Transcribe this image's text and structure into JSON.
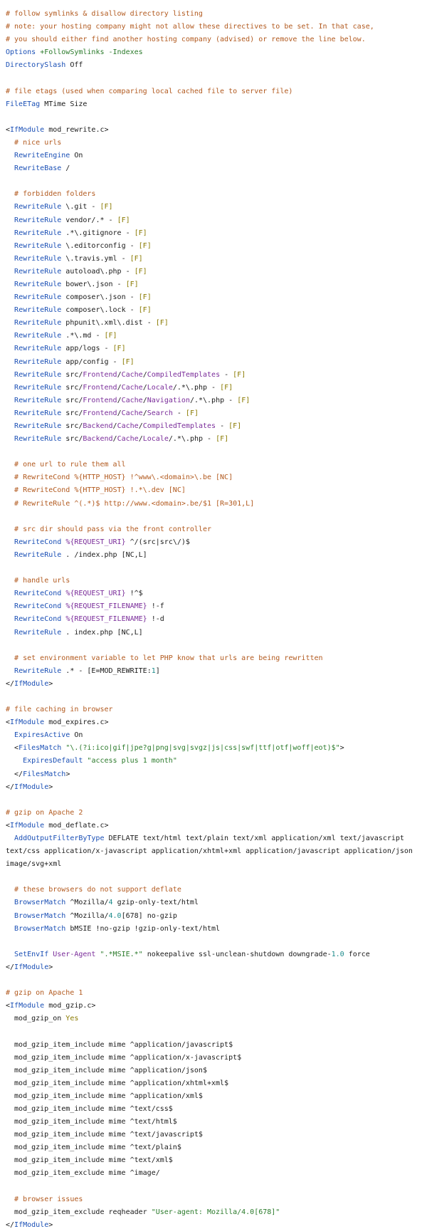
{
  "lines": [
    [
      [
        "c",
        "# follow symlinks & disallow directory listing"
      ]
    ],
    [
      [
        "c",
        "# note: your hosting company might not allow these directives to be set. In that case,"
      ]
    ],
    [
      [
        "c",
        "# you should either find another hosting company (advised) or remove the line below."
      ]
    ],
    [
      [
        "k",
        "Options"
      ],
      [
        "p",
        " "
      ],
      [
        "g",
        "+FollowSymlinks -Indexes"
      ]
    ],
    [
      [
        "k",
        "DirectorySlash"
      ],
      [
        "p",
        " Off"
      ]
    ],
    [],
    [
      [
        "c",
        "# file etags (used when comparing local cached file to server file)"
      ]
    ],
    [
      [
        "k",
        "FileETag"
      ],
      [
        "p",
        " MTime Size"
      ]
    ],
    [],
    [
      [
        "p",
        "<"
      ],
      [
        "t",
        "IfModule"
      ],
      [
        "p",
        " mod_rewrite.c>"
      ]
    ],
    [
      [
        "p",
        "  "
      ],
      [
        "c",
        "# nice urls"
      ]
    ],
    [
      [
        "p",
        "  "
      ],
      [
        "k",
        "RewriteEngine"
      ],
      [
        "p",
        " On"
      ]
    ],
    [
      [
        "p",
        "  "
      ],
      [
        "k",
        "RewriteBase"
      ],
      [
        "p",
        " /"
      ]
    ],
    [],
    [
      [
        "p",
        "  "
      ],
      [
        "c",
        "# forbidden folders"
      ]
    ],
    [
      [
        "p",
        "  "
      ],
      [
        "k",
        "RewriteRule"
      ],
      [
        "p",
        " \\.git - "
      ],
      [
        "f",
        "[F]"
      ]
    ],
    [
      [
        "p",
        "  "
      ],
      [
        "k",
        "RewriteRule"
      ],
      [
        "p",
        " vendor/.* - "
      ],
      [
        "f",
        "[F]"
      ]
    ],
    [
      [
        "p",
        "  "
      ],
      [
        "k",
        "RewriteRule"
      ],
      [
        "p",
        " .*\\.gitignore - "
      ],
      [
        "f",
        "[F]"
      ]
    ],
    [
      [
        "p",
        "  "
      ],
      [
        "k",
        "RewriteRule"
      ],
      [
        "p",
        " \\.editorconfig - "
      ],
      [
        "f",
        "[F]"
      ]
    ],
    [
      [
        "p",
        "  "
      ],
      [
        "k",
        "RewriteRule"
      ],
      [
        "p",
        " \\.travis.yml - "
      ],
      [
        "f",
        "[F]"
      ]
    ],
    [
      [
        "p",
        "  "
      ],
      [
        "k",
        "RewriteRule"
      ],
      [
        "p",
        " autoload\\.php - "
      ],
      [
        "f",
        "[F]"
      ]
    ],
    [
      [
        "p",
        "  "
      ],
      [
        "k",
        "RewriteRule"
      ],
      [
        "p",
        " bower\\.json - "
      ],
      [
        "f",
        "[F]"
      ]
    ],
    [
      [
        "p",
        "  "
      ],
      [
        "k",
        "RewriteRule"
      ],
      [
        "p",
        " composer\\.json - "
      ],
      [
        "f",
        "[F]"
      ]
    ],
    [
      [
        "p",
        "  "
      ],
      [
        "k",
        "RewriteRule"
      ],
      [
        "p",
        " composer\\.lock - "
      ],
      [
        "f",
        "[F]"
      ]
    ],
    [
      [
        "p",
        "  "
      ],
      [
        "k",
        "RewriteRule"
      ],
      [
        "p",
        " phpunit\\.xml\\.dist - "
      ],
      [
        "f",
        "[F]"
      ]
    ],
    [
      [
        "p",
        "  "
      ],
      [
        "k",
        "RewriteRule"
      ],
      [
        "p",
        " .*\\.md - "
      ],
      [
        "f",
        "[F]"
      ]
    ],
    [
      [
        "p",
        "  "
      ],
      [
        "k",
        "RewriteRule"
      ],
      [
        "p",
        " app/logs - "
      ],
      [
        "f",
        "[F]"
      ]
    ],
    [
      [
        "p",
        "  "
      ],
      [
        "k",
        "RewriteRule"
      ],
      [
        "p",
        " app/config - "
      ],
      [
        "f",
        "[F]"
      ]
    ],
    [
      [
        "p",
        "  "
      ],
      [
        "k",
        "RewriteRule"
      ],
      [
        "p",
        " src/"
      ],
      [
        "v",
        "Frontend"
      ],
      [
        "p",
        "/"
      ],
      [
        "v",
        "Cache"
      ],
      [
        "p",
        "/"
      ],
      [
        "v",
        "CompiledTemplates"
      ],
      [
        "p",
        " - "
      ],
      [
        "f",
        "[F]"
      ]
    ],
    [
      [
        "p",
        "  "
      ],
      [
        "k",
        "RewriteRule"
      ],
      [
        "p",
        " src/"
      ],
      [
        "v",
        "Frontend"
      ],
      [
        "p",
        "/"
      ],
      [
        "v",
        "Cache"
      ],
      [
        "p",
        "/"
      ],
      [
        "v",
        "Locale"
      ],
      [
        "p",
        "/.*\\.php - "
      ],
      [
        "f",
        "[F]"
      ]
    ],
    [
      [
        "p",
        "  "
      ],
      [
        "k",
        "RewriteRule"
      ],
      [
        "p",
        " src/"
      ],
      [
        "v",
        "Frontend"
      ],
      [
        "p",
        "/"
      ],
      [
        "v",
        "Cache"
      ],
      [
        "p",
        "/"
      ],
      [
        "v",
        "Navigation"
      ],
      [
        "p",
        "/.*\\.php - "
      ],
      [
        "f",
        "[F]"
      ]
    ],
    [
      [
        "p",
        "  "
      ],
      [
        "k",
        "RewriteRule"
      ],
      [
        "p",
        " src/"
      ],
      [
        "v",
        "Frontend"
      ],
      [
        "p",
        "/"
      ],
      [
        "v",
        "Cache"
      ],
      [
        "p",
        "/"
      ],
      [
        "v",
        "Search"
      ],
      [
        "p",
        " - "
      ],
      [
        "f",
        "[F]"
      ]
    ],
    [
      [
        "p",
        "  "
      ],
      [
        "k",
        "RewriteRule"
      ],
      [
        "p",
        " src/"
      ],
      [
        "v",
        "Backend"
      ],
      [
        "p",
        "/"
      ],
      [
        "v",
        "Cache"
      ],
      [
        "p",
        "/"
      ],
      [
        "v",
        "CompiledTemplates"
      ],
      [
        "p",
        " - "
      ],
      [
        "f",
        "[F]"
      ]
    ],
    [
      [
        "p",
        "  "
      ],
      [
        "k",
        "RewriteRule"
      ],
      [
        "p",
        " src/"
      ],
      [
        "v",
        "Backend"
      ],
      [
        "p",
        "/"
      ],
      [
        "v",
        "Cache"
      ],
      [
        "p",
        "/"
      ],
      [
        "v",
        "Locale"
      ],
      [
        "p",
        "/.*\\.php - "
      ],
      [
        "f",
        "[F]"
      ]
    ],
    [],
    [
      [
        "p",
        "  "
      ],
      [
        "c",
        "# one url to rule them all"
      ]
    ],
    [
      [
        "p",
        "  "
      ],
      [
        "c",
        "# RewriteCond %{HTTP_HOST} !^www\\.<domain>\\.be [NC]"
      ]
    ],
    [
      [
        "p",
        "  "
      ],
      [
        "c",
        "# RewriteCond %{HTTP_HOST} !.*\\.dev [NC]"
      ]
    ],
    [
      [
        "p",
        "  "
      ],
      [
        "c",
        "# RewriteRule ^(.*)$ http://www.<domain>.be/$1 [R=301,L]"
      ]
    ],
    [],
    [
      [
        "p",
        "  "
      ],
      [
        "c",
        "# src dir should pass via the front controller"
      ]
    ],
    [
      [
        "p",
        "  "
      ],
      [
        "k",
        "RewriteCond"
      ],
      [
        "p",
        " "
      ],
      [
        "v",
        "%{REQUEST_URI}"
      ],
      [
        "p",
        " ^/(src|src\\/)$"
      ]
    ],
    [
      [
        "p",
        "  "
      ],
      [
        "k",
        "RewriteRule"
      ],
      [
        "p",
        " . /index.php [NC,L]"
      ]
    ],
    [],
    [
      [
        "p",
        "  "
      ],
      [
        "c",
        "# handle urls"
      ]
    ],
    [
      [
        "p",
        "  "
      ],
      [
        "k",
        "RewriteCond"
      ],
      [
        "p",
        " "
      ],
      [
        "v",
        "%{REQUEST_URI}"
      ],
      [
        "p",
        " !^$"
      ]
    ],
    [
      [
        "p",
        "  "
      ],
      [
        "k",
        "RewriteCond"
      ],
      [
        "p",
        " "
      ],
      [
        "v",
        "%{REQUEST_FILENAME}"
      ],
      [
        "p",
        " !-f"
      ]
    ],
    [
      [
        "p",
        "  "
      ],
      [
        "k",
        "RewriteCond"
      ],
      [
        "p",
        " "
      ],
      [
        "v",
        "%{REQUEST_FILENAME}"
      ],
      [
        "p",
        " !-d"
      ]
    ],
    [
      [
        "p",
        "  "
      ],
      [
        "k",
        "RewriteRule"
      ],
      [
        "p",
        " . index.php [NC,L]"
      ]
    ],
    [],
    [
      [
        "p",
        "  "
      ],
      [
        "c",
        "# set environment variable to let PHP know that urls are being rewritten"
      ]
    ],
    [
      [
        "p",
        "  "
      ],
      [
        "k",
        "RewriteRule"
      ],
      [
        "p",
        " .* - [E=MOD_REWRITE:"
      ],
      [
        "n",
        "1"
      ],
      [
        "p",
        "]"
      ]
    ],
    [
      [
        "p",
        "</"
      ],
      [
        "t",
        "IfModule"
      ],
      [
        "p",
        ">"
      ]
    ],
    [],
    [
      [
        "c",
        "# file caching in browser"
      ]
    ],
    [
      [
        "p",
        "<"
      ],
      [
        "t",
        "IfModule"
      ],
      [
        "p",
        " mod_expires.c>"
      ]
    ],
    [
      [
        "p",
        "  "
      ],
      [
        "k",
        "ExpiresActive"
      ],
      [
        "p",
        " On"
      ]
    ],
    [
      [
        "p",
        "  <"
      ],
      [
        "t",
        "FilesMatch"
      ],
      [
        "p",
        " "
      ],
      [
        "s",
        "\"\\.(?i:ico|gif|jpe?g|png|svg|svgz|js|css|swf|ttf|otf|woff|eot)$\""
      ],
      [
        "p",
        ">"
      ]
    ],
    [
      [
        "p",
        "    "
      ],
      [
        "k",
        "ExpiresDefault"
      ],
      [
        "p",
        " "
      ],
      [
        "s",
        "\"access plus 1 month\""
      ]
    ],
    [
      [
        "p",
        "  </"
      ],
      [
        "t",
        "FilesMatch"
      ],
      [
        "p",
        ">"
      ]
    ],
    [
      [
        "p",
        "</"
      ],
      [
        "t",
        "IfModule"
      ],
      [
        "p",
        ">"
      ]
    ],
    [],
    [
      [
        "c",
        "# gzip on Apache 2"
      ]
    ],
    [
      [
        "p",
        "<"
      ],
      [
        "t",
        "IfModule"
      ],
      [
        "p",
        " mod_deflate.c>"
      ]
    ],
    [
      [
        "p",
        "  "
      ],
      [
        "k",
        "AddOutputFilterByType"
      ],
      [
        "p",
        " DEFLATE text/html text/plain text/xml application/xml text/javascript"
      ]
    ],
    [
      [
        "p",
        "text/css application/x-javascript application/xhtml+xml application/javascript application/json"
      ]
    ],
    [
      [
        "p",
        "image/svg+xml"
      ]
    ],
    [],
    [
      [
        "p",
        "  "
      ],
      [
        "c",
        "# these browsers do not support deflate"
      ]
    ],
    [
      [
        "p",
        "  "
      ],
      [
        "k",
        "BrowserMatch"
      ],
      [
        "p",
        " ^Mozilla/"
      ],
      [
        "n",
        "4"
      ],
      [
        "p",
        " gzip-only-text/html"
      ]
    ],
    [
      [
        "p",
        "  "
      ],
      [
        "k",
        "BrowserMatch"
      ],
      [
        "p",
        " ^Mozilla/"
      ],
      [
        "n",
        "4.0"
      ],
      [
        "p",
        "[678] no-gzip"
      ]
    ],
    [
      [
        "p",
        "  "
      ],
      [
        "k",
        "BrowserMatch"
      ],
      [
        "p",
        " bMSIE !no-gzip !gzip-only-text/html"
      ]
    ],
    [],
    [
      [
        "p",
        "  "
      ],
      [
        "k",
        "SetEnvIf"
      ],
      [
        "p",
        " "
      ],
      [
        "v",
        "User-Agent"
      ],
      [
        "p",
        " "
      ],
      [
        "s",
        "\".*MSIE.*\""
      ],
      [
        "p",
        " nokeepalive ssl-unclean-shutdown downgrade-"
      ],
      [
        "n",
        "1.0"
      ],
      [
        "p",
        " force"
      ]
    ],
    [
      [
        "p",
        "</"
      ],
      [
        "t",
        "IfModule"
      ],
      [
        "p",
        ">"
      ]
    ],
    [],
    [
      [
        "c",
        "# gzip on Apache 1"
      ]
    ],
    [
      [
        "p",
        "<"
      ],
      [
        "t",
        "IfModule"
      ],
      [
        "p",
        " mod_gzip.c>"
      ]
    ],
    [
      [
        "p",
        "  mod_gzip_on "
      ],
      [
        "f",
        "Yes"
      ]
    ],
    [],
    [
      [
        "p",
        "  mod_gzip_item_include mime ^application/javascript$"
      ]
    ],
    [
      [
        "p",
        "  mod_gzip_item_include mime ^application/x-javascript$"
      ]
    ],
    [
      [
        "p",
        "  mod_gzip_item_include mime ^application/json$"
      ]
    ],
    [
      [
        "p",
        "  mod_gzip_item_include mime ^application/xhtml+xml$"
      ]
    ],
    [
      [
        "p",
        "  mod_gzip_item_include mime ^application/xml$"
      ]
    ],
    [
      [
        "p",
        "  mod_gzip_item_include mime ^text/css$"
      ]
    ],
    [
      [
        "p",
        "  mod_gzip_item_include mime ^text/html$"
      ]
    ],
    [
      [
        "p",
        "  mod_gzip_item_include mime ^text/javascript$"
      ]
    ],
    [
      [
        "p",
        "  mod_gzip_item_include mime ^text/plain$"
      ]
    ],
    [
      [
        "p",
        "  mod_gzip_item_include mime ^text/xml$"
      ]
    ],
    [
      [
        "p",
        "  mod_gzip_item_exclude mime ^image/"
      ]
    ],
    [],
    [
      [
        "p",
        "  "
      ],
      [
        "c",
        "# browser issues"
      ]
    ],
    [
      [
        "p",
        "  mod_gzip_item_exclude reqheader "
      ],
      [
        "s",
        "\"User-agent: Mozilla/4.0[678]\""
      ]
    ],
    [
      [
        "p",
        "</"
      ],
      [
        "t",
        "IfModule"
      ],
      [
        "p",
        ">"
      ]
    ]
  ]
}
